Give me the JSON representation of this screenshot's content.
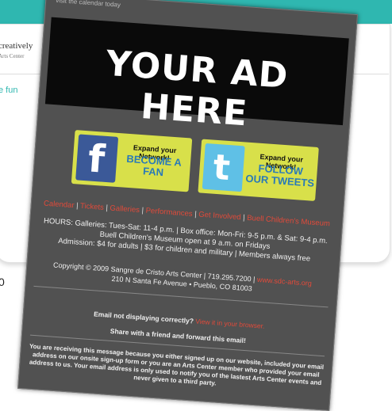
{
  "background": {
    "logo_line1": "creatively",
    "logo_line2": "Arts Center",
    "link_text": "e fun",
    "number_text": "0"
  },
  "email": {
    "top_text": "visit the calendar today",
    "ad_text": "YOUR AD HERE",
    "facebook": {
      "line1": "Expand your Network!",
      "line2": "BECOME A FAN"
    },
    "twitter": {
      "line1": "Expand your Network!",
      "line2": "FOLLOW OUR TWEETS"
    },
    "nav": [
      "Calendar",
      "Tickets",
      "Galleries",
      "Performances",
      "Get Involved",
      "Buell Children's Museum"
    ],
    "hours_line1": "HOURS: Galleries: Tues-Sat: 11-4 p.m. | Box office: Mon-Fri: 9-5 p.m. & Sat: 9-4 p.m.",
    "hours_line2": "Buell Children's Museum open at 9 a.m. on Fridays",
    "admission": "Admission: $4 for adults | $3 for children and military | Members always free",
    "copyright_line1": "Copyright © 2009 Sangre de Cristo Arts Center | 719.295.7200 |",
    "copyright_link": "www.sdc-arts.org",
    "copyright_line2": "210 N Santa Fe Avenue • Pueblo, CO 81003",
    "email_not_displaying": "Email not displaying correctly?",
    "view_in_browser": "View it in your browser.",
    "share": "Share with a friend and forward this email!",
    "receiving": "You are receiving this message because you either signed up on our website, included your email address on our onsite sign-up form or you are an Arts Center member who provided your email address to us. Your email address is only used to notify you of the lastest Arts Center events and never given to a third party."
  },
  "colors": {
    "teal": "#2fb7b0",
    "email_bg": "#515151",
    "accent_red": "#e14a3a",
    "social_green": "#d8e04a"
  }
}
